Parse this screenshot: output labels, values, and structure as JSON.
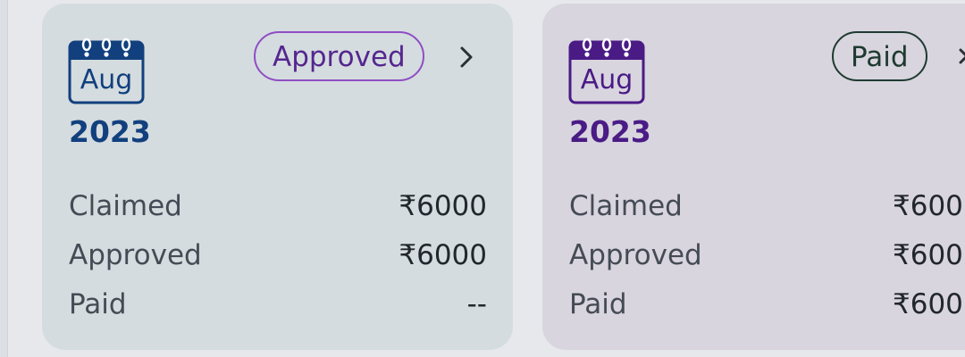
{
  "cards": [
    {
      "month": "Aug",
      "year": "2023",
      "status": "Approved",
      "rows": [
        {
          "label": "Claimed",
          "value": "₹6000"
        },
        {
          "label": "Approved",
          "value": "₹6000"
        },
        {
          "label": "Paid",
          "value": "--"
        }
      ],
      "icons": {
        "calendar": "calendar-icon",
        "chevron": "chevron-right-icon"
      },
      "colors": {
        "accent": "#12407e",
        "badge_border": "#8f4ec4",
        "badge_text": "#55268f",
        "card_bg": "#d5dcdf"
      }
    },
    {
      "month": "Aug",
      "year": "2023",
      "status": "Paid",
      "rows": [
        {
          "label": "Claimed",
          "value": "₹600"
        },
        {
          "label": "Approved",
          "value": "₹600"
        },
        {
          "label": "Paid",
          "value": "₹600"
        }
      ],
      "icons": {
        "calendar": "calendar-icon",
        "close": "close-icon"
      },
      "colors": {
        "accent": "#4a1b85",
        "badge_border": "#1f3a30",
        "badge_text": "#1f3a30",
        "card_bg": "#d8d5df"
      }
    }
  ]
}
